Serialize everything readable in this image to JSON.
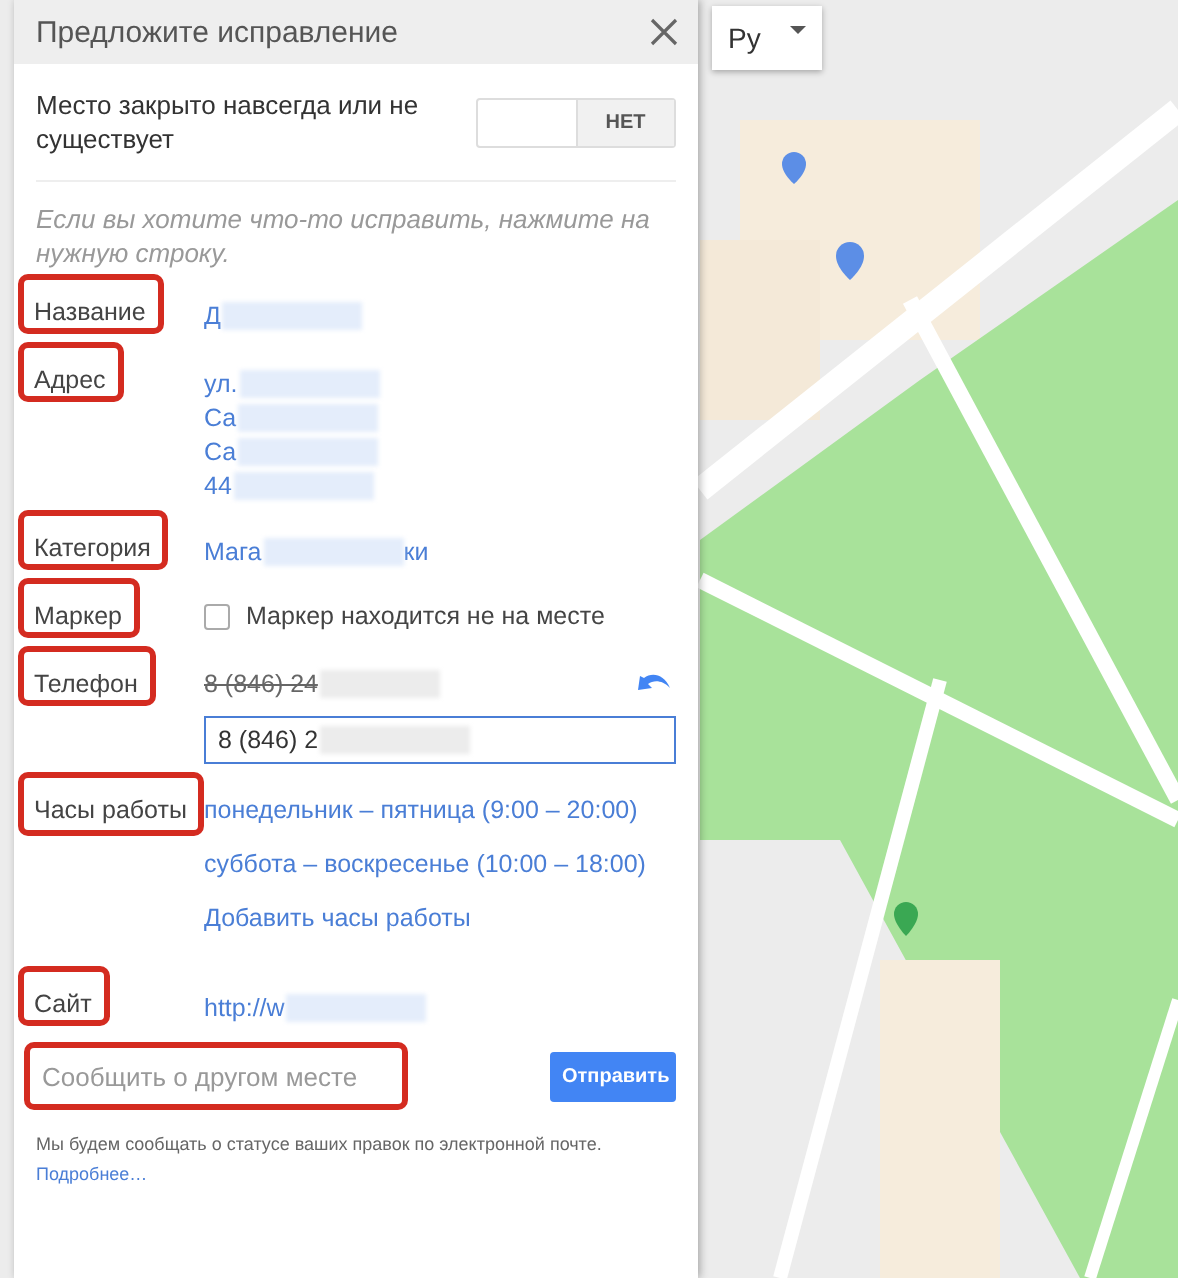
{
  "dialog": {
    "title": "Предложите исправление"
  },
  "closed_toggle": {
    "label": "Место закрыто навсегда или не существует",
    "option": "НЕТ",
    "on": false
  },
  "hint": "Если вы хотите что-то исправить, нажмите на нужную строку.",
  "fields": [
    {
      "kind": "link",
      "label": "Название",
      "highlighted": true,
      "lines": [
        {
          "text": "Д"
        }
      ]
    },
    {
      "kind": "link",
      "label": "Адрес",
      "highlighted": true,
      "lines": [
        {
          "text": "ул."
        },
        {
          "text": "Са"
        },
        {
          "text": "Са"
        },
        {
          "text": "44"
        }
      ]
    },
    {
      "kind": "link",
      "label": "Категория",
      "highlighted": true,
      "lines": [
        {
          "text": "Мага",
          "tail": "ки"
        }
      ]
    },
    {
      "kind": "checkbox",
      "label": "Маркер",
      "highlighted": true,
      "text": "Маркер находится не на месте",
      "checked": false
    },
    {
      "kind": "phone",
      "label": "Телефон",
      "highlighted": true,
      "old_value": "8 (846) 24",
      "edited": true,
      "value": "8 (846) 2"
    },
    {
      "kind": "hours",
      "label": "Часы работы",
      "highlighted": true,
      "lines": [
        "понедельник – пятница (9:00 – 20:00)",
        "суббота – воскресенье (10:00 – 18:00)"
      ],
      "add_link": "Добавить часы работы"
    },
    {
      "kind": "link",
      "label": "Сайт",
      "highlighted": true,
      "lines": [
        {
          "text": "http://w"
        }
      ]
    }
  ],
  "report": {
    "placeholder": "Сообщить о другом месте",
    "highlighted": true
  },
  "submit_button": "Отправить",
  "footer": {
    "text": "Мы будем сообщать о статусе ваших правок по электронной почте.",
    "link": "Подробнее…"
  },
  "map": {
    "language": "Ру"
  }
}
